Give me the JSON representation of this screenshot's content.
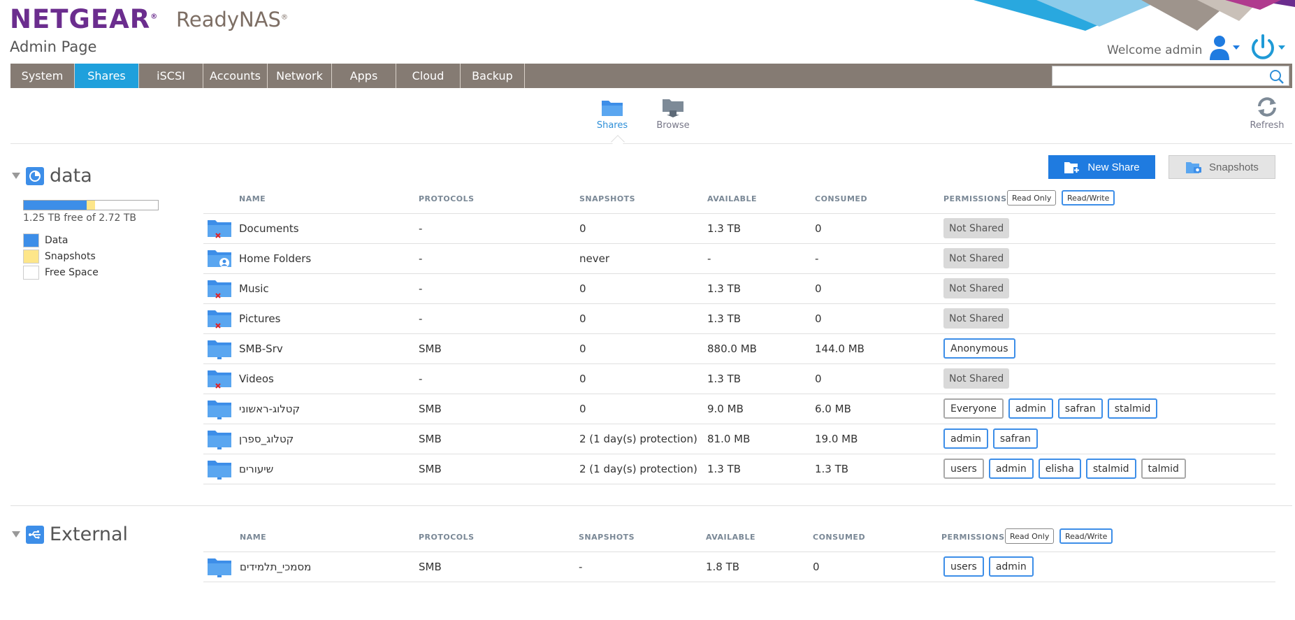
{
  "header": {
    "logo": "NETGEAR",
    "product": "ReadyNAS",
    "subtitle": "Admin Page",
    "welcome": "Welcome admin"
  },
  "nav": {
    "tabs": [
      {
        "label": "System",
        "active": false
      },
      {
        "label": "Shares",
        "active": true
      },
      {
        "label": "iSCSI",
        "active": false
      },
      {
        "label": "Accounts",
        "active": false
      },
      {
        "label": "Network",
        "active": false
      },
      {
        "label": "Apps",
        "active": false
      },
      {
        "label": "Cloud",
        "active": false
      },
      {
        "label": "Backup",
        "active": false
      }
    ],
    "search_value": ""
  },
  "subnav": {
    "shares": "Shares",
    "browse": "Browse",
    "refresh": "Refresh"
  },
  "volume_data": {
    "name": "data",
    "usage_text": "1.25 TB free of 2.72 TB",
    "data_fraction": 0.47,
    "snapshot_fraction": 0.06,
    "legend": [
      {
        "label": "Data",
        "color": "#3d8ee8"
      },
      {
        "label": "Snapshots",
        "color": "#fde68a"
      },
      {
        "label": "Free Space",
        "color": "#ffffff"
      }
    ]
  },
  "volume_external": {
    "name": "External"
  },
  "actions": {
    "new_share": "New Share",
    "snapshots": "Snapshots"
  },
  "columns": {
    "name": "NAME",
    "protocols": "PROTOCOLS",
    "snapshots": "SNAPSHOTS",
    "available": "AVAILABLE",
    "consumed": "CONSUMED",
    "permissions": "PERMISSIONS",
    "read_only": "Read Only",
    "read_write": "Read/Write"
  },
  "shares": [
    {
      "name": "Documents",
      "protocols": "-",
      "snapshots": "0",
      "available": "1.3 TB",
      "consumed": "0",
      "icon": "folder-unshared",
      "perms": [
        {
          "label": "Not Shared",
          "kind": "ns"
        }
      ]
    },
    {
      "name": "Home Folders",
      "protocols": "-",
      "snapshots": "never",
      "available": "-",
      "consumed": "-",
      "icon": "folder-home",
      "perms": [
        {
          "label": "Not Shared",
          "kind": "ns"
        }
      ]
    },
    {
      "name": "Music",
      "protocols": "-",
      "snapshots": "0",
      "available": "1.3 TB",
      "consumed": "0",
      "icon": "folder-unshared",
      "perms": [
        {
          "label": "Not Shared",
          "kind": "ns"
        }
      ]
    },
    {
      "name": "Pictures",
      "protocols": "-",
      "snapshots": "0",
      "available": "1.3 TB",
      "consumed": "0",
      "icon": "folder-unshared",
      "perms": [
        {
          "label": "Not Shared",
          "kind": "ns"
        }
      ]
    },
    {
      "name": "SMB-Srv",
      "protocols": "SMB",
      "snapshots": "0",
      "available": "880.0 MB",
      "consumed": "144.0 MB",
      "icon": "folder-network",
      "perms": [
        {
          "label": "Anonymous",
          "kind": "anon"
        }
      ]
    },
    {
      "name": "Videos",
      "protocols": "-",
      "snapshots": "0",
      "available": "1.3 TB",
      "consumed": "0",
      "icon": "folder-unshared",
      "perms": [
        {
          "label": "Not Shared",
          "kind": "ns"
        }
      ]
    },
    {
      "name": "קטלוג-ראשוני",
      "protocols": "SMB",
      "snapshots": "0",
      "available": "9.0 MB",
      "consumed": "6.0 MB",
      "icon": "folder-network",
      "perms": [
        {
          "label": "Everyone",
          "kind": "ro"
        },
        {
          "label": "admin",
          "kind": "rw"
        },
        {
          "label": "safran",
          "kind": "rw"
        },
        {
          "label": "stalmid",
          "kind": "rw"
        }
      ]
    },
    {
      "name": "קטלוג_ספרן",
      "protocols": "SMB",
      "snapshots": "2 (1 day(s) protection)",
      "available": "81.0 MB",
      "consumed": "19.0 MB",
      "icon": "folder-network",
      "perms": [
        {
          "label": "admin",
          "kind": "rw"
        },
        {
          "label": "safran",
          "kind": "rw"
        }
      ]
    },
    {
      "name": "שיעורים",
      "protocols": "SMB",
      "snapshots": "2 (1 day(s) protection)",
      "available": "1.3 TB",
      "consumed": "1.3 TB",
      "icon": "folder-network",
      "perms": [
        {
          "label": "users",
          "kind": "ro"
        },
        {
          "label": "admin",
          "kind": "rw"
        },
        {
          "label": "elisha",
          "kind": "rw"
        },
        {
          "label": "stalmid",
          "kind": "rw"
        },
        {
          "label": "talmid",
          "kind": "ro"
        }
      ]
    }
  ],
  "external_shares": [
    {
      "name": "מסמכי_תלמידים",
      "protocols": "SMB",
      "snapshots": "-",
      "available": "1.8 TB",
      "consumed": "0",
      "icon": "folder-network",
      "perms": [
        {
          "label": "users",
          "kind": "rw"
        },
        {
          "label": "admin",
          "kind": "rw"
        }
      ]
    }
  ]
}
